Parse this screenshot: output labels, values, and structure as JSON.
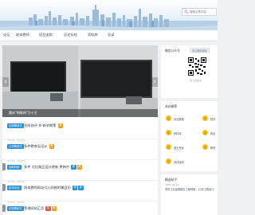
{
  "search": {
    "placeholder": "搜索文章内容"
  },
  "nav": [
    "论坛",
    "校本教师",
    "项目追踪",
    "历史存档",
    "资料库",
    "导读"
  ],
  "slider": {
    "caption": "重庆\"物联网\"力十主",
    "dots": 3,
    "active_dot": 1
  },
  "posts": [
    {
      "category": "优秀教研文",
      "title": "岳阳创评 乡·新学期策",
      "badges": [
        {
          "text": "荐",
          "color": "#f0a020"
        }
      ]
    },
    {
      "category": "小学教研文",
      "title": "条件教育无设计",
      "badges": [
        {
          "text": "荐",
          "color": "#f0a020"
        }
      ]
    },
    {
      "category": "创新科研",
      "title": "条件 对比商品设计更新 更新中",
      "badges": [
        {
          "text": "新",
          "color": "#2b8fd6"
        },
        {
          "text": "荐",
          "color": "#f0a020"
        }
      ]
    },
    {
      "category": "技术杂谈",
      "title": "校本教师网站引入网络附属会(Ⅰ)",
      "badges": [
        {
          "text": "荐",
          "color": "#2b8fd6"
        },
        {
          "text": "新",
          "color": "#2b8fd6"
        }
      ]
    },
    {
      "category": "优秀教研文",
      "title": "等理网站汇总",
      "badges": [
        {
          "text": "热",
          "color": "#e2574c"
        },
        {
          "text": "荐",
          "color": "#f0a020"
        }
      ]
    }
  ],
  "sidebar": {
    "wechat": {
      "title": "微信公众号",
      "tab": "关注微信网站",
      "qr_text": "扫一扫关注"
    },
    "recommend": {
      "title": "本站推荐",
      "items": [
        "本站数据",
        "数学",
        "资料库",
        "政治",
        "语文专家",
        "教育",
        "测试版块"
      ]
    },
    "news": {
      "title": "精选帖子",
      "date": "2016-01-01",
      "text": "重庆江北星城新区工程网络，10月工程设计"
    }
  }
}
